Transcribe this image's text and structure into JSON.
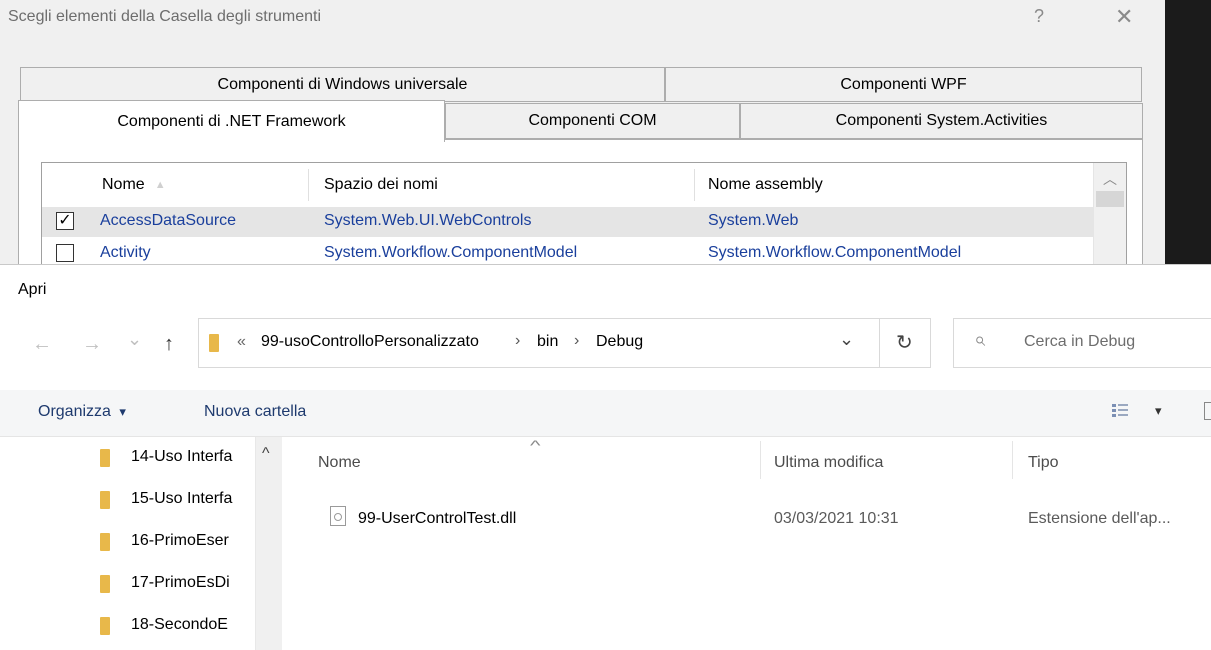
{
  "toolbox_dialog": {
    "title": "Scegli elementi della Casella degli strumenti",
    "help_label": "?",
    "close_label": "✕",
    "tabs_row1": [
      "Componenti di Windows universale",
      "Componenti WPF"
    ],
    "tabs_row2": [
      "Componenti di .NET Framework",
      "Componenti COM",
      "Componenti System.Activities"
    ],
    "active_tab": "Componenti di .NET Framework",
    "grid": {
      "columns": [
        "Nome",
        "Spazio dei nomi",
        "Nome assembly"
      ],
      "sort_indicator": "▲",
      "rows": [
        {
          "checked": true,
          "check_mark": "✓",
          "name": "AccessDataSource",
          "namespace": "System.Web.UI.WebControls",
          "assembly": "System.Web"
        },
        {
          "checked": false,
          "check_mark": "",
          "name": "Activity",
          "namespace": "System.Workflow.ComponentModel",
          "assembly": "System.Workflow.ComponentModel"
        }
      ],
      "scroll_up_glyph": "︿"
    }
  },
  "open_dialog": {
    "title": "Apri",
    "nav": {
      "back": "←",
      "forward": "→",
      "recent": "⌄",
      "up": "↑"
    },
    "address": {
      "overflow": "«",
      "separator": "›",
      "segments": [
        "99-usoControlloPersonalizzato",
        "bin",
        "Debug"
      ],
      "dropdown_glyph": "⌄",
      "refresh_glyph": "↻"
    },
    "search": {
      "placeholder": "Cerca in Debug",
      "icon_glyph": "⌕"
    },
    "command_bar": {
      "organize": "Organizza",
      "organize_caret": "▾",
      "new_folder": "Nuova cartella",
      "view_caret": "▾"
    },
    "nav_pane": {
      "items": [
        "14-Uso Interfa",
        "15-Uso Interfa",
        "16-PrimoEser",
        "17-PrimoEsDi",
        "18-SecondoE"
      ],
      "scroll_up_glyph": "^"
    },
    "file_list": {
      "columns": [
        "Nome",
        "Ultima modifica",
        "Tipo"
      ],
      "sort_glyph": "^",
      "files": [
        {
          "name": "99-UserControlTest.dll",
          "modified": "03/03/2021 10:31",
          "type": "Estensione dell'ap..."
        }
      ]
    }
  },
  "colors": {
    "folder": "#e8b84a",
    "link_text": "#1a3f9c",
    "selected_row": "#e5e5e5"
  }
}
